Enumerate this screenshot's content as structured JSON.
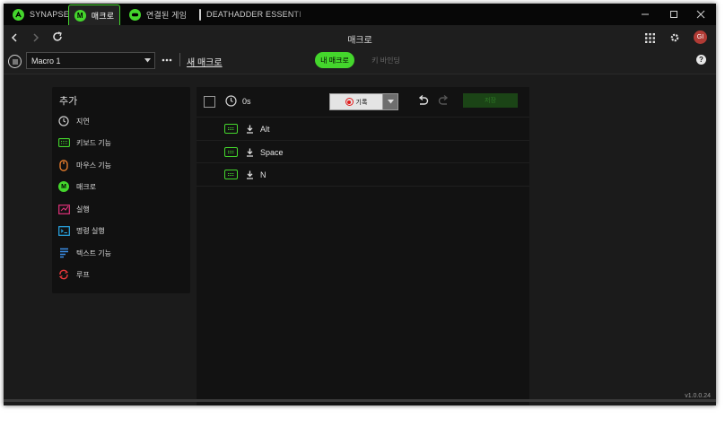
{
  "titlebar": {
    "tabs": [
      {
        "label": "SYNAPSE",
        "icon": "razer-logo-icon"
      },
      {
        "label": "매크로",
        "icon": "macro-m-icon",
        "icon_text": "M",
        "active": true
      },
      {
        "label": "연결된 게임",
        "icon": "gamepad-icon"
      },
      {
        "label": "DEATHADDER ESSENTIAL",
        "icon": "mouse-icon"
      }
    ]
  },
  "navbar": {
    "title": "매크로",
    "profile_initials": "GI"
  },
  "toolbar": {
    "macro_select_value": "Macro 1",
    "new_macro_label": "새 매크로",
    "toggle_my_macro": "내 매크로",
    "toggle_key_binding": "키 바인딩",
    "help_label": "?"
  },
  "add_panel": {
    "header": "추가",
    "items": [
      {
        "label": "지연",
        "icon": "clock-icon"
      },
      {
        "label": "키보드 기능",
        "icon": "keyboard-icon"
      },
      {
        "label": "마우스 기능",
        "icon": "mouse-icon"
      },
      {
        "label": "매크로",
        "icon": "macro-m-icon",
        "icon_text": "M"
      },
      {
        "label": "실행",
        "icon": "launch-icon"
      },
      {
        "label": "명령 실행",
        "icon": "command-icon"
      },
      {
        "label": "텍스트 기능",
        "icon": "text-icon"
      },
      {
        "label": "루프",
        "icon": "loop-icon"
      }
    ]
  },
  "editor": {
    "duration": "0s",
    "record_label": "기록",
    "save_label": "저장",
    "rows": [
      {
        "label": "Alt"
      },
      {
        "label": "Space"
      },
      {
        "label": "N"
      }
    ]
  },
  "version": "v1.0.0.24",
  "colors": {
    "accent": "#44d62c",
    "launch": "#e0327a",
    "mouse": "#f0822e",
    "command": "#2aa7e6",
    "text": "#3b8ee8",
    "loop": "#e8373a",
    "record": "#e21a1a"
  }
}
